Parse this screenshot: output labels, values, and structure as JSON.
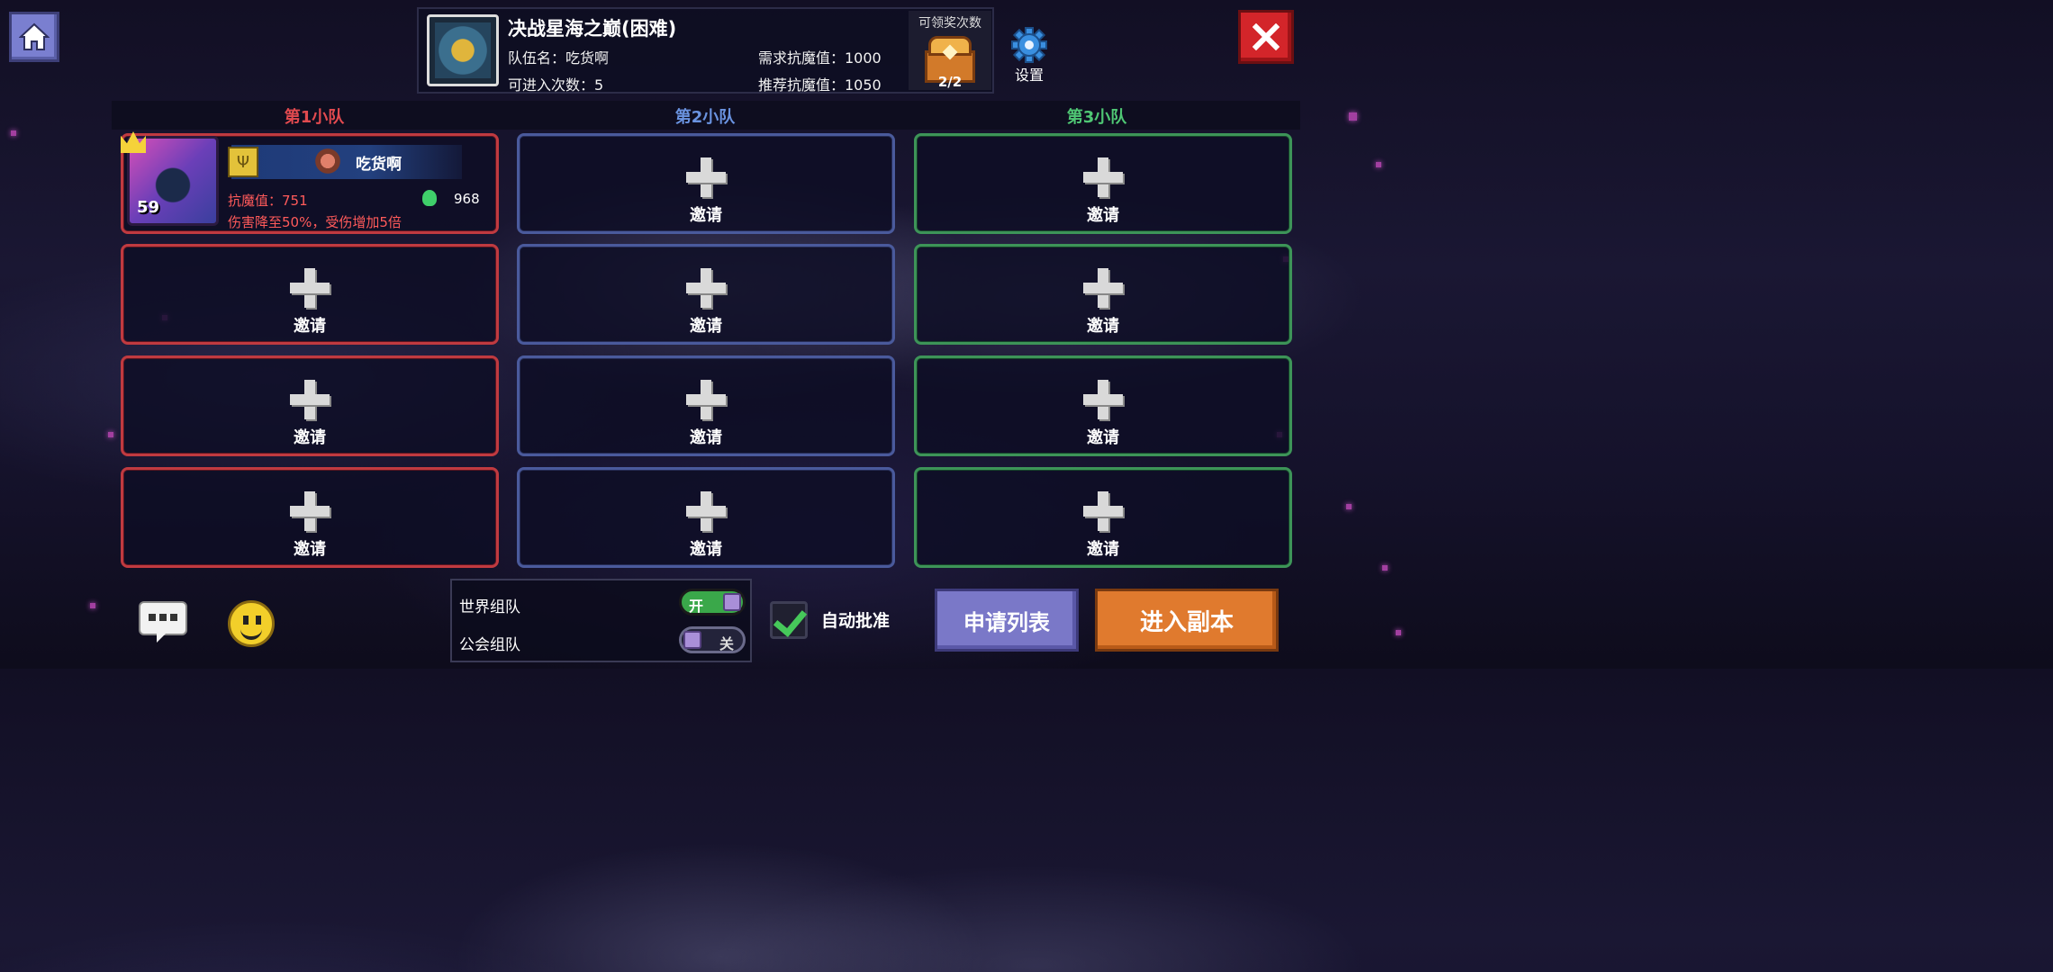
{
  "icons": {
    "home": "home-icon",
    "close": "close-icon",
    "settings": "gear-icon",
    "reward": "treasure-chest-icon",
    "chat": "chat-bubble-icon",
    "emoji": "smiley-icon",
    "check": "checkmark-icon"
  },
  "colors": {
    "team1": "#e24a4f",
    "team2": "#6a93e0",
    "team3": "#4fc774",
    "accent_enter": "#e07a2e",
    "accent_apply": "#7a78c8"
  },
  "dungeon": {
    "title": "决战星海之巅(困难)",
    "team_name": "队伍名：吃货啊",
    "entries": "可进入次数：5",
    "required_resist": "需求抗魔值：1000",
    "recommended_resist": "推荐抗魔值：1050"
  },
  "reward": {
    "label": "可领奖次数",
    "count": "2/2"
  },
  "settings_label": "设置",
  "teams": [
    {
      "title": "第1小队"
    },
    {
      "title": "第2小队"
    },
    {
      "title": "第3小队"
    }
  ],
  "invite_label": "邀请",
  "member": {
    "name": "吃货啊",
    "level": "59",
    "resist": "抗魔值：751",
    "power": "968",
    "debuff": "伤害降至50%，受伤增加5倍"
  },
  "toggles": {
    "world_label": "世界组队",
    "world_state": "开",
    "guild_label": "公会组队",
    "guild_state": "关"
  },
  "auto_approve": "自动批准",
  "buttons": {
    "apply_list": "申请列表",
    "enter_dungeon": "进入副本"
  }
}
